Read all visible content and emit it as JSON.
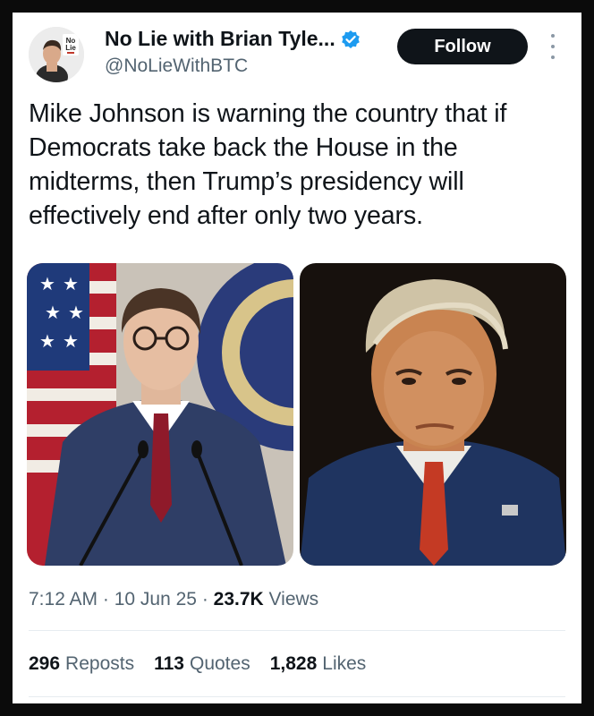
{
  "author": {
    "display_name": "No Lie with Brian Tyle...",
    "handle": "@NoLieWithBTC",
    "verified": true,
    "avatar_badge": {
      "line1": "No",
      "line2": "Lie"
    }
  },
  "follow_label": "Follow",
  "tweet": {
    "text": "Mike Johnson is warning the country that if Democrats take back the House in the midterms, then Trump’s presidency will effectively end after only two years."
  },
  "meta": {
    "time": "7:12 AM",
    "sep1": " · ",
    "date": "10 Jun 25",
    "sep2": " · ",
    "views_count": "23.7K",
    "views_label": " Views"
  },
  "stats": {
    "reposts_count": "296",
    "reposts_label": "Reposts",
    "quotes_count": "113",
    "quotes_label": "Quotes",
    "likes_count": "1,828",
    "likes_label": "Likes"
  },
  "colors": {
    "accent": "#1d9bf0",
    "text_primary": "#0f1419",
    "text_secondary": "#536471",
    "follow_bg": "#0f1419"
  }
}
